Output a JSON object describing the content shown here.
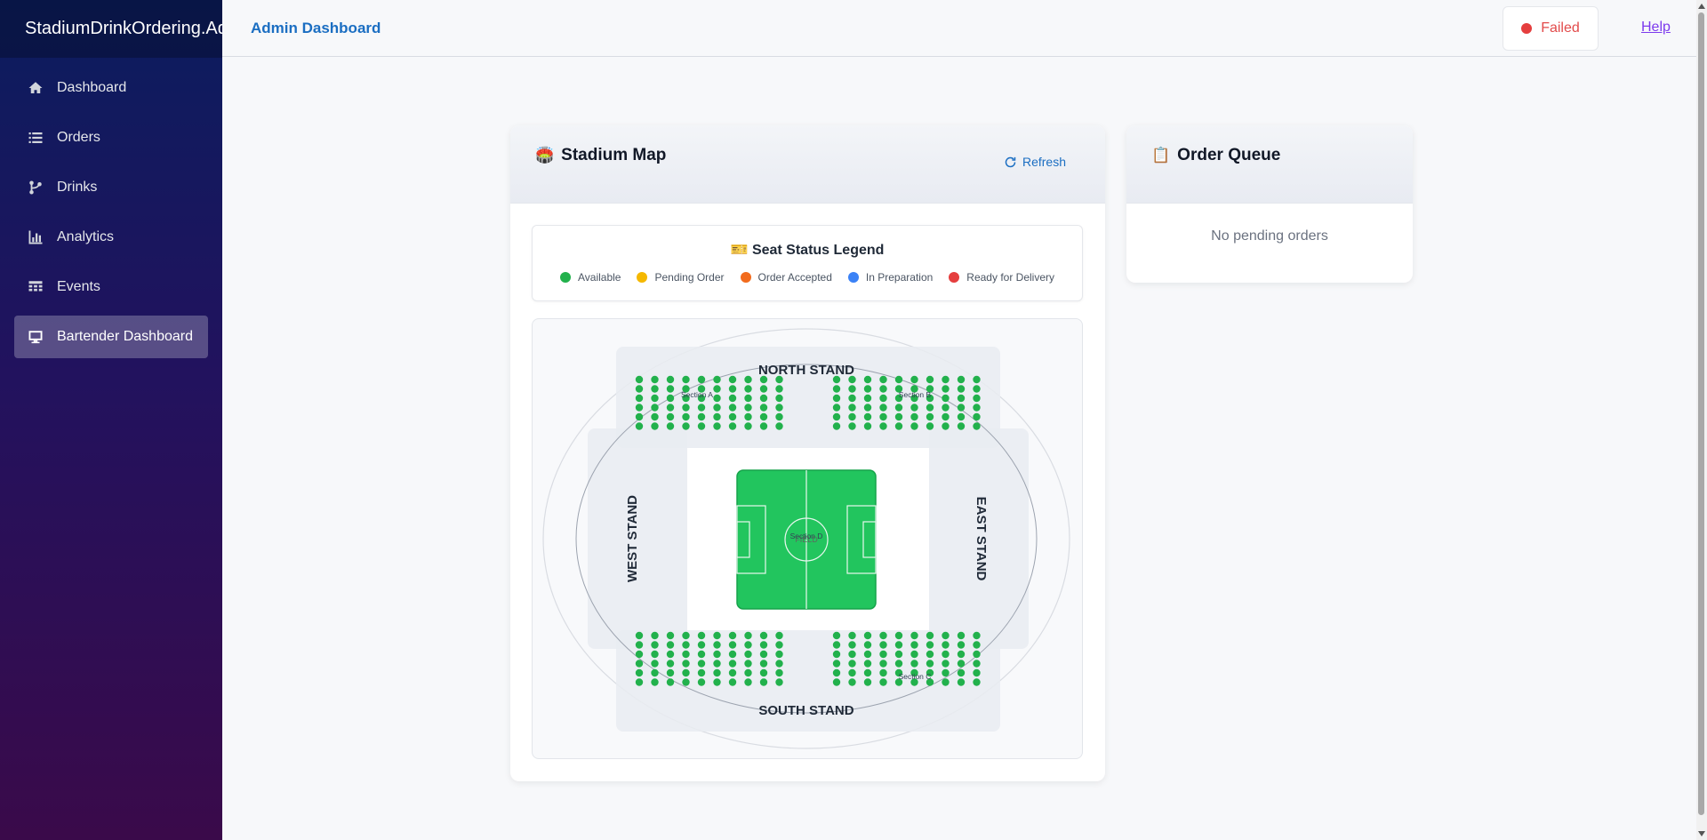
{
  "app": {
    "brand": "StadiumDrinkOrdering.Admin"
  },
  "sidebar": {
    "items": [
      {
        "label": "Dashboard",
        "icon": "home-icon",
        "active": false
      },
      {
        "label": "Orders",
        "icon": "list-icon",
        "active": false
      },
      {
        "label": "Drinks",
        "icon": "branch-icon",
        "active": false
      },
      {
        "label": "Analytics",
        "icon": "bar-chart-icon",
        "active": false
      },
      {
        "label": "Events",
        "icon": "calendar-icon",
        "active": false
      },
      {
        "label": "Bartender Dashboard",
        "icon": "monitor-icon",
        "active": true
      }
    ]
  },
  "topbar": {
    "title": "Admin Dashboard",
    "status": "Failed",
    "status_color": "#e53e3e",
    "help": "Help"
  },
  "stadium": {
    "title": "Stadium Map",
    "refresh": "Refresh",
    "legend_title": "Seat Status Legend",
    "legend": [
      {
        "label": "Available",
        "color": "#22b14c"
      },
      {
        "label": "Pending Order",
        "color": "#f5b800"
      },
      {
        "label": "Order Accepted",
        "color": "#f26b1d"
      },
      {
        "label": "In Preparation",
        "color": "#3b82f6"
      },
      {
        "label": "Ready for Delivery",
        "color": "#e53e3e"
      }
    ],
    "stands": {
      "north": "NORTH STAND",
      "south": "SOUTH STAND",
      "west": "WEST STAND",
      "east": "EAST STAND"
    },
    "sections": {
      "a": "Section A",
      "b": "Section B",
      "c": "Section C",
      "d": "Section D"
    },
    "field_label": "FIELD",
    "seat_color": "#22b14c"
  },
  "queue": {
    "title": "Order Queue",
    "empty": "No pending orders"
  }
}
